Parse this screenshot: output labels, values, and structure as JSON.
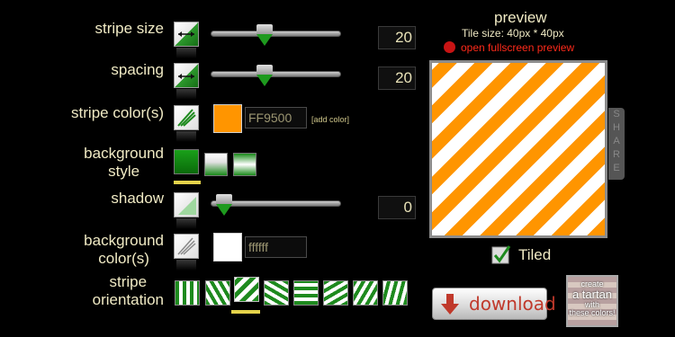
{
  "labels": {
    "stripe_size": "stripe size",
    "spacing": "spacing",
    "stripe_colors": "stripe color(s)",
    "background_style_line1": "background",
    "background_style_line2": "style",
    "shadow": "shadow",
    "background_colors_line1": "background",
    "background_colors_line2": "color(s)",
    "stripe_orientation_line1": "stripe",
    "stripe_orientation_line2": "orientation"
  },
  "controls": {
    "stripe_size": {
      "value": "20",
      "slider_fraction": 0.4
    },
    "spacing": {
      "value": "20",
      "slider_fraction": 0.4
    },
    "shadow": {
      "value": "0",
      "slider_fraction": 0.05
    },
    "stripe_color": {
      "hex": "FF9500",
      "swatch": "#ff9500",
      "add_label": "[add color]"
    },
    "background_color": {
      "hex": "ffffff",
      "swatch": "#ffffff"
    },
    "background_style_selected": 0,
    "orientation_selected": 2
  },
  "preview": {
    "title": "preview",
    "tile_size": "Tile size: 40px * 40px",
    "fullscreen_link": "open fullscreen preview",
    "share_label": [
      "S",
      "H",
      "A",
      "R",
      "E"
    ],
    "tiled_label": "Tiled",
    "tiled_checked": true
  },
  "buttons": {
    "download": "download",
    "tartan_line1": "create",
    "tartan_line2": "a tartan",
    "tartan_line3": "with",
    "tartan_line4": "these colors!"
  },
  "colors": {
    "stripe": "#ff9500",
    "background": "#ffffff",
    "accent_green": "#1e9a1e",
    "label": "#f0eac4",
    "link_red": "#ff2a1a",
    "selection_yellow": "#e4d24a"
  }
}
